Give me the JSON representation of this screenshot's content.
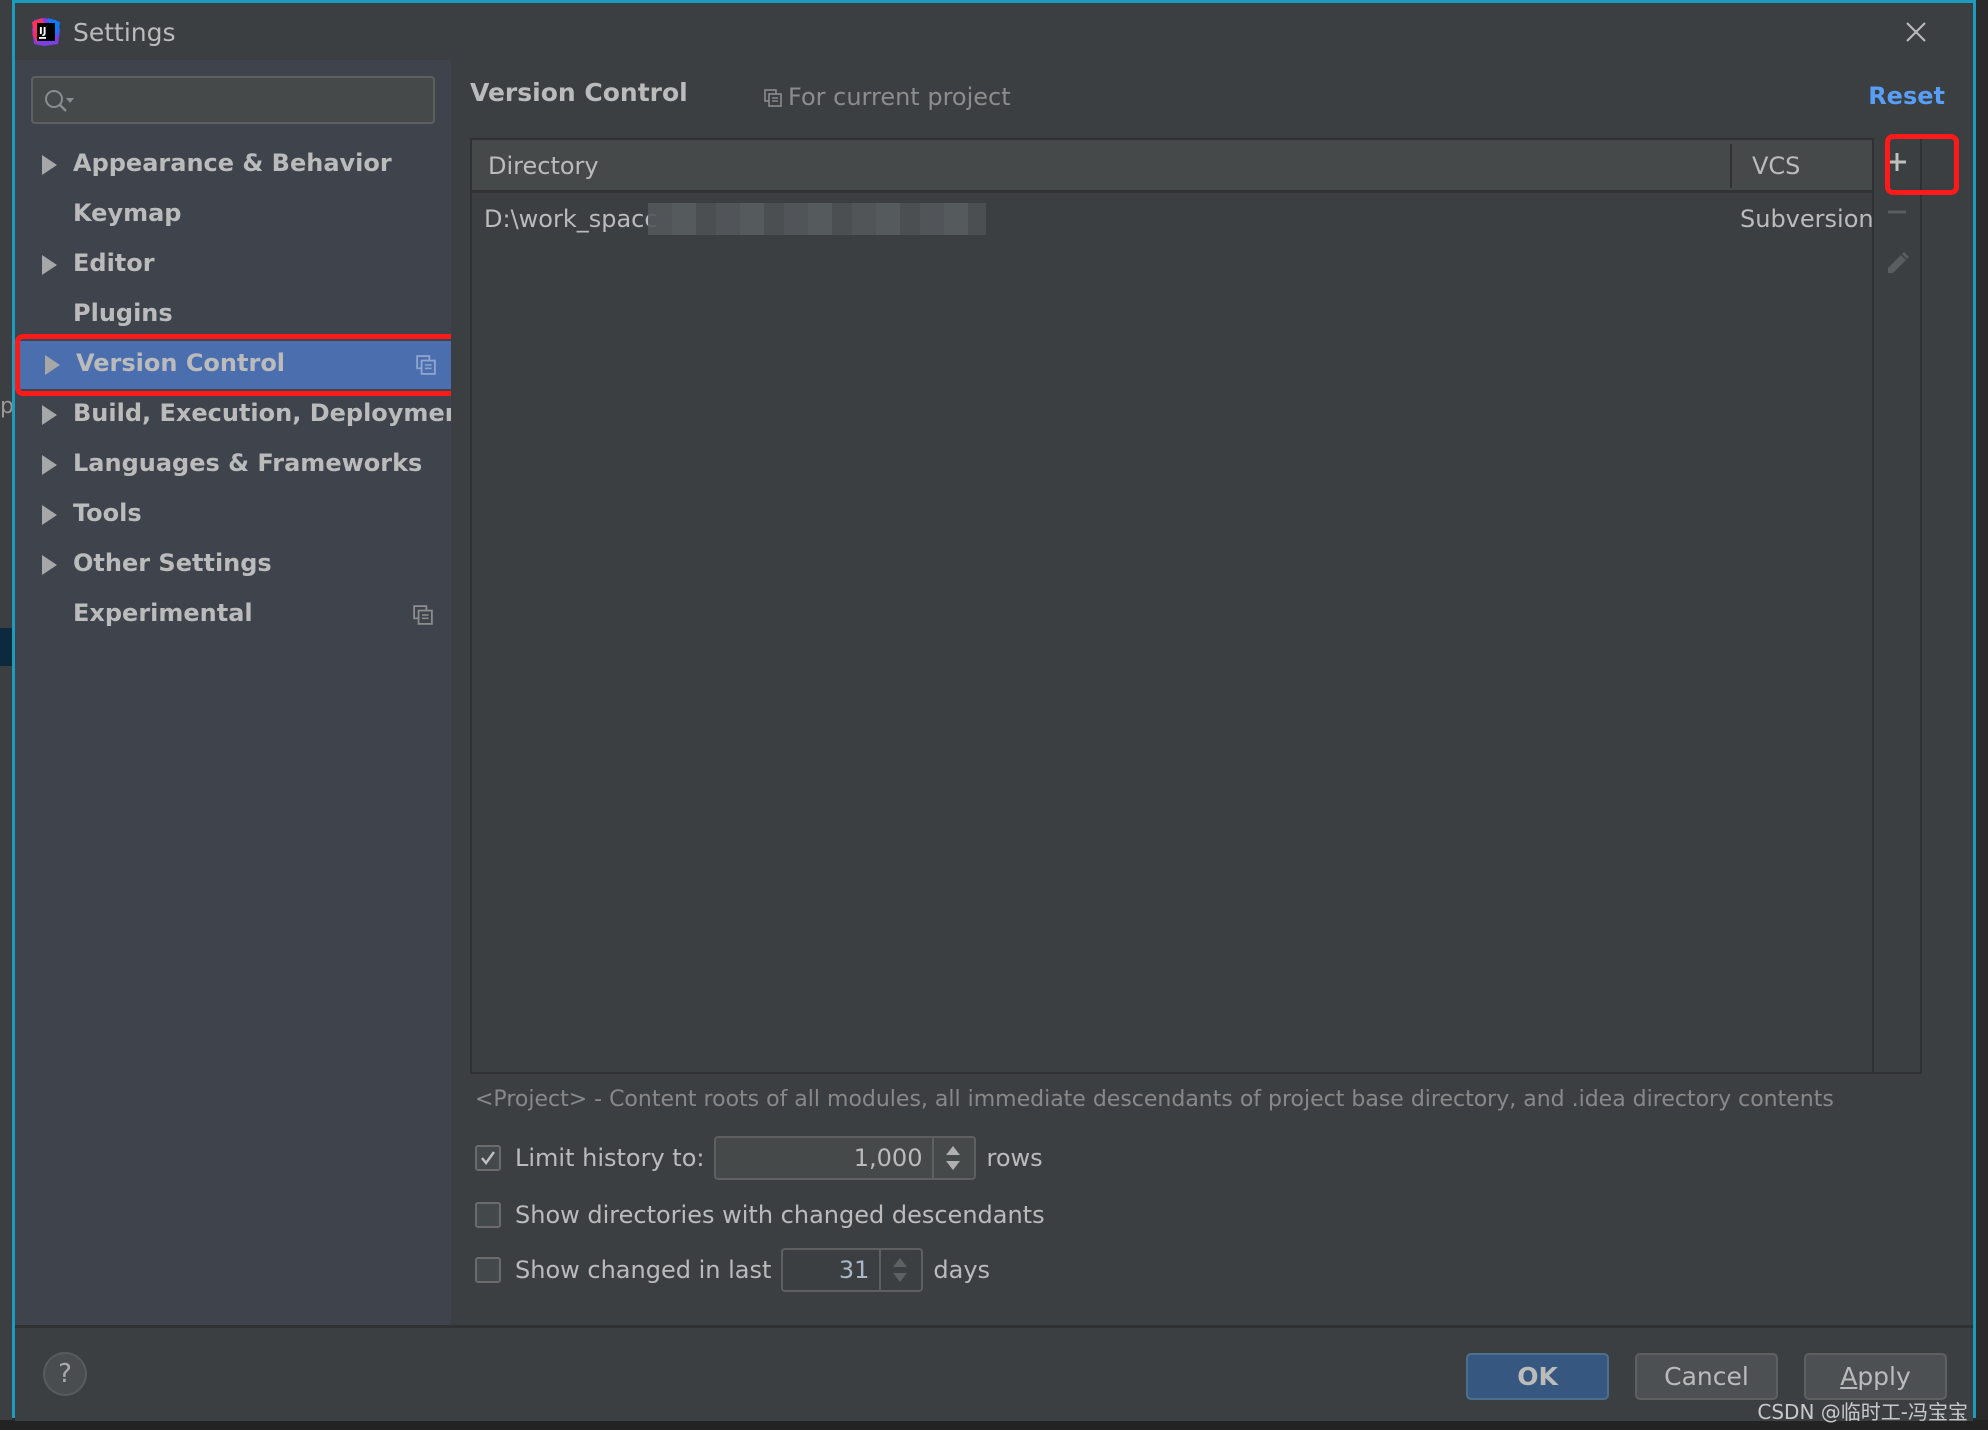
{
  "window": {
    "title": "Settings",
    "app_icon": "intellij-idea-icon",
    "close_icon": "close-icon"
  },
  "sidebar": {
    "search": {
      "value": "",
      "placeholder": ""
    },
    "items": [
      {
        "label": "Appearance & Behavior",
        "expandable": true,
        "selected": false,
        "project_scope": false
      },
      {
        "label": "Keymap",
        "expandable": false,
        "selected": false,
        "project_scope": false
      },
      {
        "label": "Editor",
        "expandable": true,
        "selected": false,
        "project_scope": false
      },
      {
        "label": "Plugins",
        "expandable": false,
        "selected": false,
        "project_scope": false
      },
      {
        "label": "Version Control",
        "expandable": true,
        "selected": true,
        "project_scope": true
      },
      {
        "label": "Build, Execution, Deployment",
        "expandable": true,
        "selected": false,
        "project_scope": false
      },
      {
        "label": "Languages & Frameworks",
        "expandable": true,
        "selected": false,
        "project_scope": false
      },
      {
        "label": "Tools",
        "expandable": true,
        "selected": false,
        "project_scope": false
      },
      {
        "label": "Other Settings",
        "expandable": true,
        "selected": false,
        "project_scope": false
      },
      {
        "label": "Experimental",
        "expandable": false,
        "selected": false,
        "project_scope": true
      }
    ]
  },
  "main": {
    "title": "Version Control",
    "scope_label": "For current project",
    "reset_label": "Reset",
    "table": {
      "columns": [
        "Directory",
        "VCS"
      ],
      "rows": [
        {
          "directory": "D:\\work_spacc",
          "vcs": "Subversion"
        }
      ]
    },
    "toolbar": {
      "add_icon": "plus-icon",
      "remove_icon": "minus-icon",
      "edit_icon": "pencil-icon"
    },
    "note": "<Project> - Content roots of all modules, all immediate descendants of project base directory, and .idea directory contents",
    "options": {
      "limit_history": {
        "label": "Limit history to:",
        "checked": true,
        "value": "1,000",
        "suffix": "rows"
      },
      "show_dirs": {
        "label": "Show directories with changed descendants",
        "checked": false
      },
      "show_changed": {
        "label": "Show changed in last",
        "checked": false,
        "value": "31",
        "suffix": "days"
      }
    }
  },
  "footer": {
    "help_label": "?",
    "ok_label": "OK",
    "cancel_label": "Cancel",
    "apply_label_mnemonic": "A",
    "apply_label_rest": "pply"
  },
  "watermark": "CSDN @临时工-冯宝宝",
  "colors": {
    "accent": "#589df6",
    "selection": "#4b6eaf",
    "highlight_box": "#ff1a1a",
    "window_border": "#1d9bbf"
  }
}
